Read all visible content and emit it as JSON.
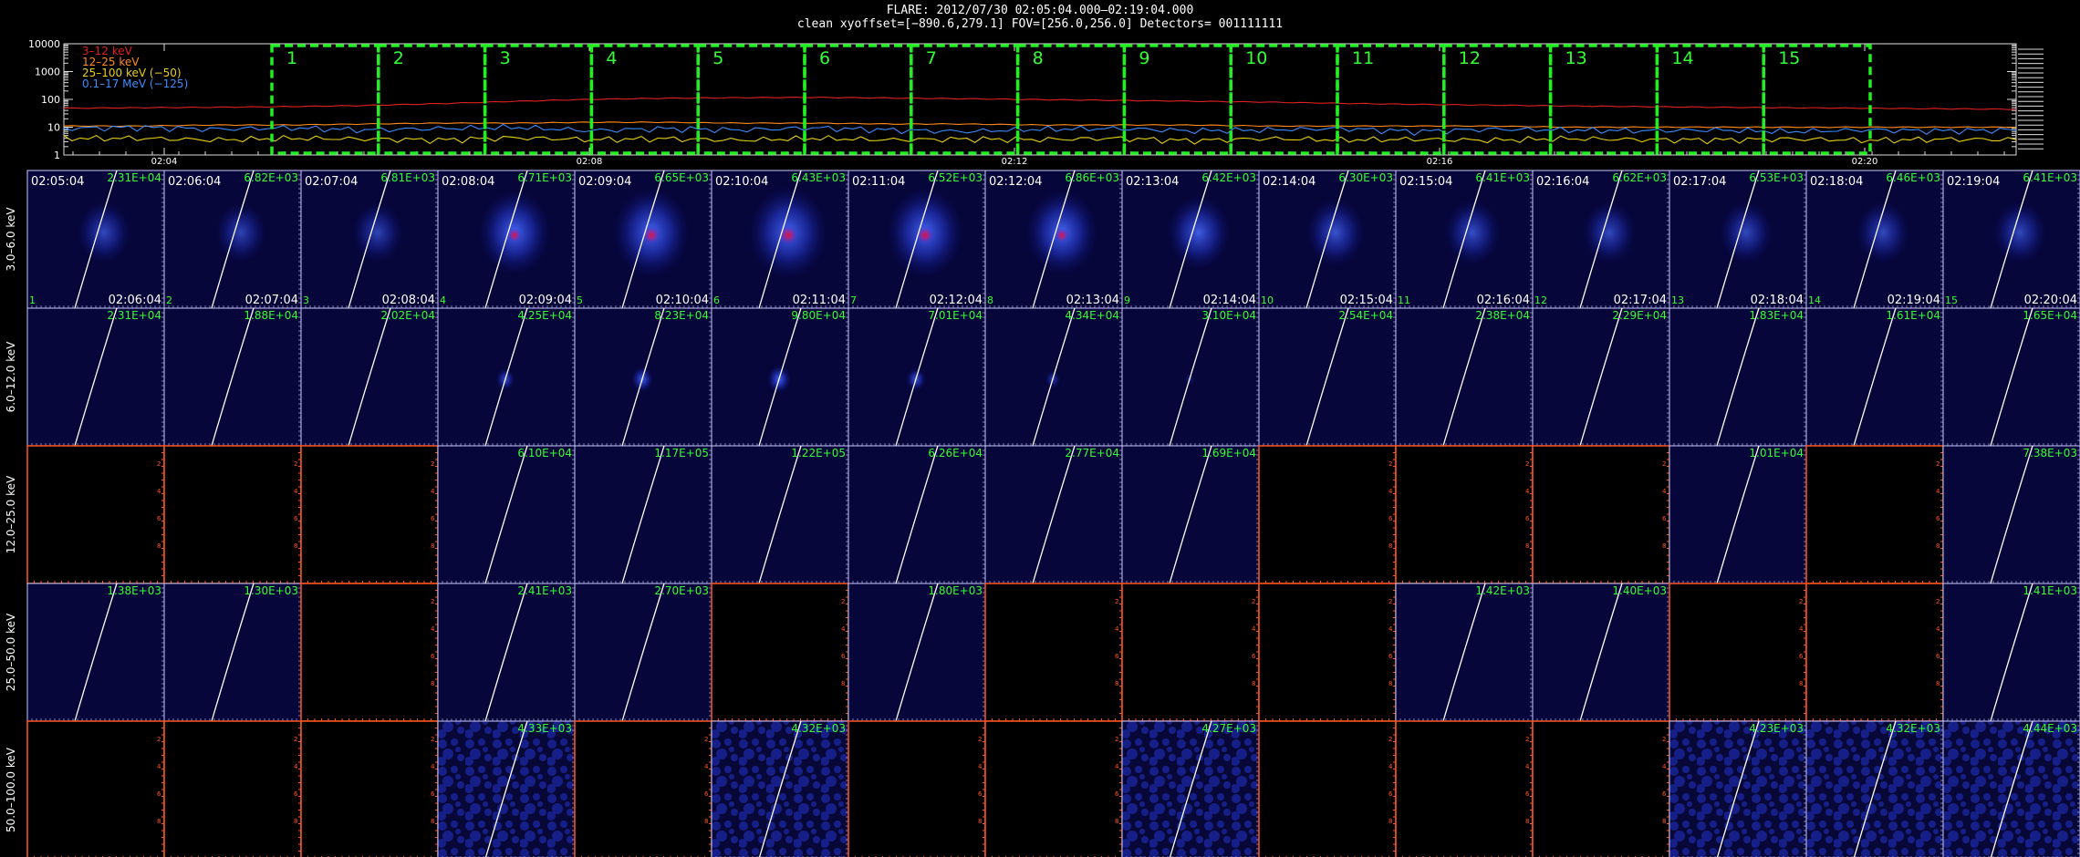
{
  "header": {
    "line1": "FLARE: 2012/07/30 02:05:04.000–02:19:04.000",
    "line2": "clean    xyoffset=[−890.6,279.1]    FOV=[256.0,256.0]    Detectors= 001111111"
  },
  "colors": {
    "band_3_12": "#e02020",
    "band_12_25": "#ff8c1a",
    "band_25_100": "#e8d010",
    "band_01_17": "#3a8cff",
    "box": "#22ee22",
    "label": "#33ff33",
    "empty_axes": "#ff5522",
    "image_axes": "#c8c8ff"
  },
  "chart_data": [
    {
      "type": "line",
      "name": "lightcurve",
      "yscale": "log",
      "ylim": [
        1,
        10000
      ],
      "ytick_labels": [
        "10000",
        "1000",
        "100",
        "10",
        "1"
      ],
      "xtick_labels": [
        "02:04",
        "02:08",
        "02:12",
        "02:16",
        "02:20"
      ],
      "legend": [
        "3–12 keV",
        "12–25 keV",
        "25–100 keV (−50)",
        "0.1–17 MeV (−125)"
      ],
      "legend_placement": "top-left",
      "time_bins": [
        "1",
        "2",
        "3",
        "4",
        "5",
        "6",
        "7",
        "8",
        "9",
        "10",
        "11",
        "12",
        "13",
        "14",
        "15"
      ],
      "series": [
        {
          "name": "3–12 keV",
          "color": "#e02020",
          "values": [
            48,
            50,
            52,
            55,
            60,
            70,
            85,
            100,
            110,
            115,
            118,
            112,
            105,
            98,
            92,
            86,
            80,
            72,
            66,
            62,
            58,
            55,
            52,
            50,
            48,
            46,
            44
          ]
        },
        {
          "name": "12–25 keV",
          "color": "#ff8c1a",
          "values": [
            11,
            11,
            12,
            12,
            13,
            14,
            14,
            15,
            15,
            14,
            14,
            13,
            13,
            12,
            12,
            12,
            11,
            11,
            11,
            11,
            10,
            10,
            10,
            10,
            10,
            10,
            10
          ]
        },
        {
          "name": "25–100 keV (−50)",
          "color": "#e8d010",
          "values": [
            4,
            4,
            3.5,
            4,
            3.8,
            3.5,
            4.2,
            3.6,
            3.9,
            3.4,
            4,
            3.5,
            3.8,
            3.6,
            4,
            3.3,
            3.9,
            3.5,
            3.7,
            3.4,
            3.9,
            3.6,
            3.5,
            3.8,
            3.4,
            3.7,
            3.6
          ]
        },
        {
          "name": "0.1–17 MeV (−125)",
          "color": "#3a8cff",
          "values": [
            9,
            10,
            8.5,
            9.5,
            8,
            9,
            10,
            7.5,
            9,
            8,
            9.5,
            8,
            7,
            8.5,
            9,
            7.5,
            8,
            9,
            7,
            8.5,
            8,
            7.5,
            8,
            7,
            8,
            7.5,
            8
          ]
        }
      ]
    },
    {
      "type": "heatmap",
      "name": "image-grid",
      "energy_bands": [
        "3.0–6.0 keV",
        "6.0–12.0 keV",
        "12.0–25.0 keV",
        "25.0–50.0 keV",
        "50.0–100.0 keV"
      ],
      "start_times": [
        "02:05:04",
        "02:06:04",
        "02:07:04",
        "02:08:04",
        "02:09:04",
        "02:10:04",
        "02:11:04",
        "02:12:04",
        "02:13:04",
        "02:14:04",
        "02:15:04",
        "02:16:04",
        "02:17:04",
        "02:18:04",
        "02:19:04"
      ],
      "end_times": [
        "02:06:04",
        "02:07:04",
        "02:08:04",
        "02:09:04",
        "02:10:04",
        "02:11:04",
        "02:12:04",
        "02:13:04",
        "02:14:04",
        "02:15:04",
        "02:16:04",
        "02:17:04",
        "02:18:04",
        "02:19:04",
        "02:20:04"
      ],
      "bin_numbers": [
        "1",
        "2",
        "3",
        "4",
        "5",
        "6",
        "7",
        "8",
        "9",
        "10",
        "11",
        "12",
        "13",
        "14",
        "15"
      ],
      "peaks": [
        [
          "2.31E+04",
          "6.82E+03",
          "6.81E+03",
          "6.71E+03",
          "6.65E+03",
          "6.43E+03",
          "6.52E+03",
          "6.86E+03",
          "6.42E+03",
          "6.30E+03",
          "6.41E+03",
          "6.62E+03",
          "6.53E+03",
          "6.46E+03",
          "6.41E+03"
        ],
        [
          "2.31E+04",
          "1.88E+04",
          "2.02E+04",
          "4.25E+04",
          "8.23E+04",
          "9.80E+04",
          "7.01E+04",
          "4.34E+04",
          "3.10E+04",
          "2.54E+04",
          "2.38E+04",
          "2.29E+04",
          "1.83E+04",
          "1.61E+04",
          "1.65E+04"
        ],
        [
          "",
          "",
          "",
          "6.10E+04",
          "1.17E+05",
          "1.22E+05",
          "6.26E+04",
          "2.77E+04",
          "1.69E+04",
          "",
          "",
          "",
          "1.01E+04",
          "",
          "7.38E+03"
        ],
        [
          "1.38E+03",
          "1.30E+03",
          "",
          "2.41E+03",
          "2.70E+03",
          "",
          "1.80E+03",
          "",
          "",
          "",
          "1.42E+03",
          "1.40E+03",
          "",
          "",
          "1.41E+03"
        ],
        [
          "",
          "",
          "",
          "4.33E+03",
          "",
          "4.32E+03",
          "",
          "",
          "4.27E+03",
          "",
          "",
          "",
          "4.23E+03",
          "4.32E+03",
          "4.44E+03"
        ]
      ],
      "source_intensity": [
        [
          0.45,
          0.4,
          0.4,
          0.85,
          0.95,
          1.0,
          0.95,
          0.85,
          0.65,
          0.55,
          0.5,
          0.45,
          0.45,
          0.45,
          0.45
        ],
        [
          0,
          0,
          0,
          0.55,
          0.7,
          0.8,
          0.6,
          0.35,
          0.1,
          0,
          0,
          0,
          0,
          0,
          0
        ],
        [
          0,
          0,
          0,
          0,
          0,
          0,
          0,
          0,
          0,
          0,
          0,
          0,
          0,
          0,
          0
        ],
        [
          0,
          0,
          0,
          0,
          0,
          0,
          0,
          0,
          0,
          0,
          0,
          0,
          0,
          0,
          0
        ],
        [
          0,
          0,
          0,
          0,
          0,
          0,
          0,
          0,
          0,
          0,
          0,
          0,
          0,
          0,
          0
        ]
      ],
      "blank_tick_labels": [
        "2",
        "4",
        "6",
        "8"
      ]
    }
  ]
}
